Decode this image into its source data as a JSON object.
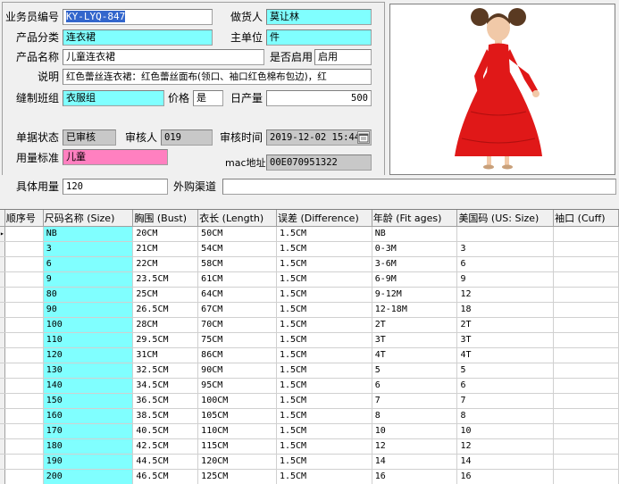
{
  "form": {
    "salesperson_label": "业务员编号",
    "salesperson_value": "KY-LYQ-847",
    "merchandiser_label": "做货人",
    "merchandiser_value": "莫让林",
    "category_label": "产品分类",
    "category_value": "连衣裙",
    "unit_label": "主单位",
    "unit_value": "件",
    "product_name_label": "产品名称",
    "product_name_value": "儿童连衣裙",
    "enabled_label": "是否启用",
    "enabled_value": "启用",
    "desc_label": "说明",
    "desc_value": "红色蕾丝连衣裙：红色蕾丝面布(领口、袖口红色棉布包边)，红",
    "team_label": "缝制班组",
    "team_value": "衣服组",
    "price_label": "价格",
    "price_value": "是",
    "daily_label": "日产量",
    "daily_value": "500",
    "status_label": "单据状态",
    "status_value": "已审核",
    "reviewer_label": "审核人",
    "reviewer_value": "019",
    "review_time_label": "审核时间",
    "review_time_value": "2019-12-02 15:44",
    "usage_std_label": "用量标准",
    "usage_std_value": "儿童",
    "mac_label": "mac地址",
    "mac_value": "00E070951322",
    "usage_label": "具体用量",
    "usage_value": "120",
    "channel_label": "外购渠道",
    "channel_value": ""
  },
  "colors": {
    "cyan": "#80ffff",
    "pink": "#ff80c0",
    "gray": "#c8c8c8",
    "dress_red": "#e01818"
  },
  "icons": {
    "calendar": "calendar-icon",
    "row_pointer": "row-pointer-icon"
  },
  "grid": {
    "columns": [
      "顺序号",
      "尺码名称 (Size)",
      "胸围 (Bust)",
      "衣长 (Length)",
      "误差 (Difference)",
      "年龄 (Fit ages)",
      "美国码 (US: Size)",
      "袖口 (Cuff)"
    ],
    "rows": [
      [
        "",
        "NB",
        "20CM",
        "50CM",
        "1.5CM",
        "NB",
        "",
        ""
      ],
      [
        "",
        "3",
        "21CM",
        "54CM",
        "1.5CM",
        "0-3M",
        "3",
        ""
      ],
      [
        "",
        "6",
        "22CM",
        "58CM",
        "1.5CM",
        "3-6M",
        "6",
        ""
      ],
      [
        "",
        "9",
        "23.5CM",
        "61CM",
        "1.5CM",
        "6-9M",
        "9",
        ""
      ],
      [
        "",
        "80",
        "25CM",
        "64CM",
        "1.5CM",
        "9-12M",
        "12",
        ""
      ],
      [
        "",
        "90",
        "26.5CM",
        "67CM",
        "1.5CM",
        "12-18M",
        "18",
        ""
      ],
      [
        "",
        "100",
        "28CM",
        "70CM",
        "1.5CM",
        "2T",
        "2T",
        ""
      ],
      [
        "",
        "110",
        "29.5CM",
        "75CM",
        "1.5CM",
        "3T",
        "3T",
        ""
      ],
      [
        "",
        "120",
        "31CM",
        "86CM",
        "1.5CM",
        "4T",
        "4T",
        ""
      ],
      [
        "",
        "130",
        "32.5CM",
        "90CM",
        "1.5CM",
        "5",
        "5",
        ""
      ],
      [
        "",
        "140",
        "34.5CM",
        "95CM",
        "1.5CM",
        "6",
        "6",
        ""
      ],
      [
        "",
        "150",
        "36.5CM",
        "100CM",
        "1.5CM",
        "7",
        "7",
        ""
      ],
      [
        "",
        "160",
        "38.5CM",
        "105CM",
        "1.5CM",
        "8",
        "8",
        ""
      ],
      [
        "",
        "170",
        "40.5CM",
        "110CM",
        "1.5CM",
        "10",
        "10",
        ""
      ],
      [
        "",
        "180",
        "42.5CM",
        "115CM",
        "1.5CM",
        "12",
        "12",
        ""
      ],
      [
        "",
        "190",
        "44.5CM",
        "120CM",
        "1.5CM",
        "14",
        "14",
        ""
      ],
      [
        "",
        "200",
        "46.5CM",
        "125CM",
        "1.5CM",
        "16",
        "16",
        ""
      ]
    ]
  }
}
